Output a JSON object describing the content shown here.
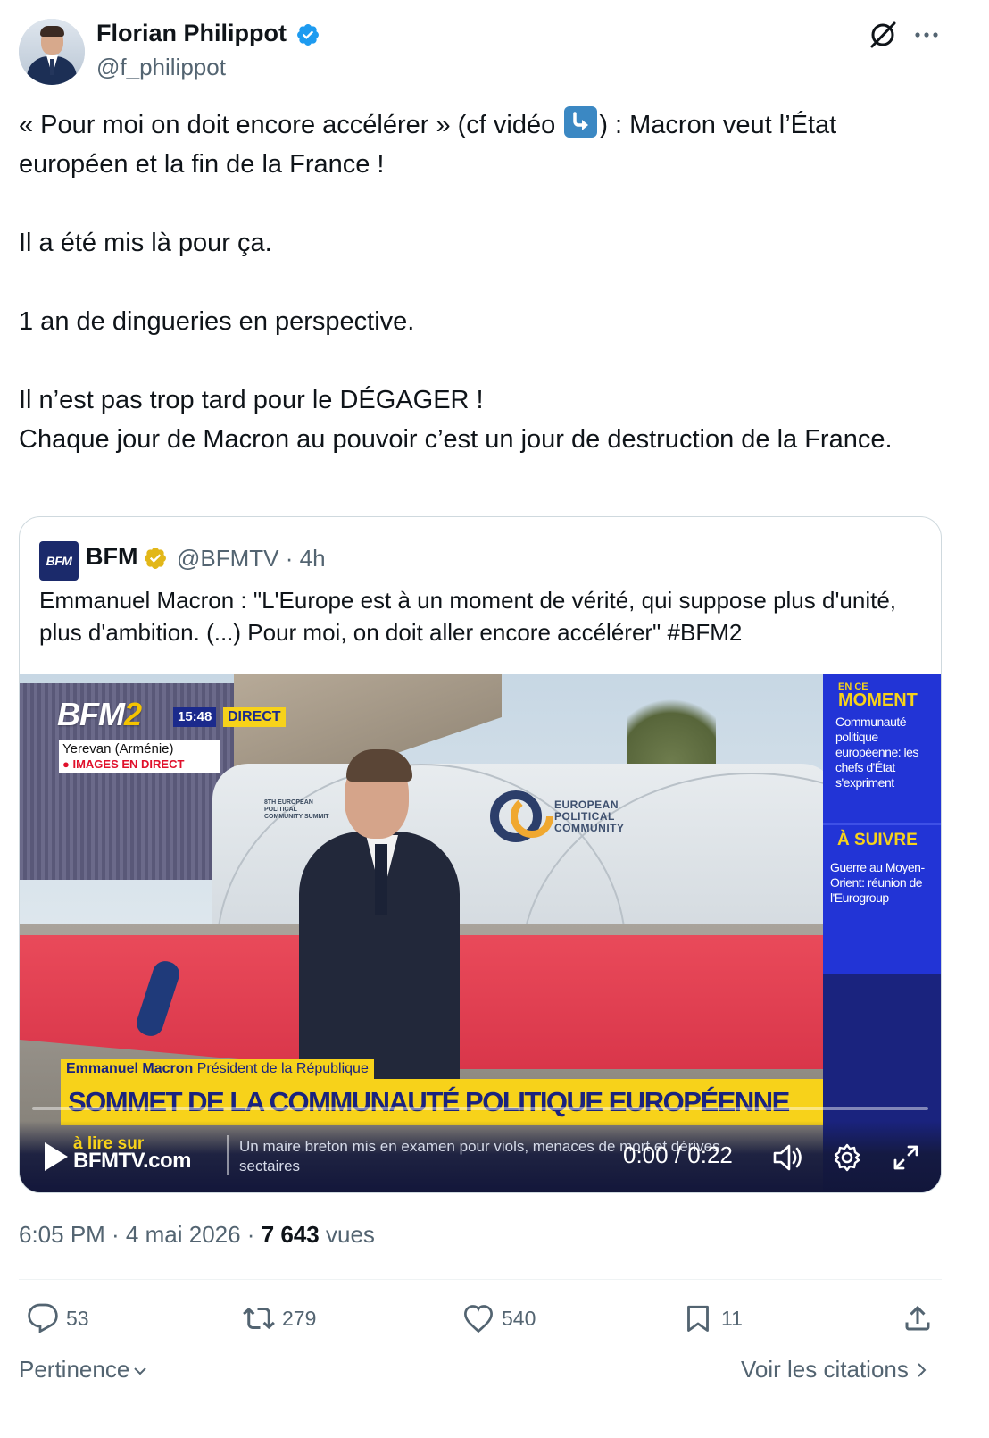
{
  "author": {
    "name": "Florian Philippot",
    "handle": "@f_philippot"
  },
  "tweet": {
    "lines": [
      "« Pour moi on doit encore accélérer » (cf vidéo ",
      ") : Macron veut l’État européen et la fin de la France !",
      "",
      "Il a été mis là pour ça.",
      "",
      "1 an de dingueries en perspective.",
      "",
      "Il n’est pas trop tard pour le DÉGAGER !",
      "Chaque jour de Macron au pouvoir c’est un jour de destruction de la France."
    ],
    "emoji": "arrow-down-right-emoji"
  },
  "quote": {
    "logo_text": "BFM",
    "name": "BFM",
    "handle_time": "@BFMTV · 4h",
    "text": "Emmanuel Macron : \"L'Europe est à un moment de vérité, qui suppose plus d'unité, plus d'ambition. (...) Pour moi, on doit aller encore accélérer\" #BFM2",
    "video": {
      "channel_logo": "BFM",
      "channel_logo_num": "2",
      "clock": "15:48",
      "direct": "DIRECT",
      "location": "Yerevan (Arménie)",
      "live_label": "● IMAGES EN DIRECT",
      "wall_summit_text": "8TH EUROPEAN POLITICAL COMMUNITY SUMMIT",
      "wall_logo_text": "EUROPEAN POLITICAL COMMUNITY",
      "panel_now_small": "EN CE",
      "panel_now_big": "MOMENT",
      "panel_now_text": "Communauté politique européenne: les chefs d'État s'expriment",
      "panel_next_title": "À SUIVRE",
      "panel_next_text": "Guerre au Moyen-Orient: réunion de l'Eurogroup",
      "speaker_name": "Emmanuel Macron",
      "speaker_title": "Président de la République",
      "headline": "SOMMET DE LA COMMUNAUTÉ POLITIQUE EUROPÉENNE",
      "ticker_src_small": "à lire sur",
      "ticker_src_big": "BFMTV.com",
      "ticker_text": "Un maire breton mis en examen pour viols, menaces de mort et dérives sectaires",
      "time": "0:00 / 0:22"
    }
  },
  "meta": {
    "time_date": "6:05 PM · 4 mai 2026 · ",
    "views_count": "7 643",
    "views_label": " vues"
  },
  "actions": {
    "replies": "53",
    "reposts": "279",
    "likes": "540",
    "bookmarks": "11"
  },
  "footer": {
    "sort": "Pertinence",
    "quotes": "Voir les citations"
  },
  "colors": {
    "verified_blue": "#1d9bf0",
    "verified_gold": "#e2b719",
    "bfm_blue": "#2234d6",
    "bfm_yellow": "#f7d21a"
  }
}
